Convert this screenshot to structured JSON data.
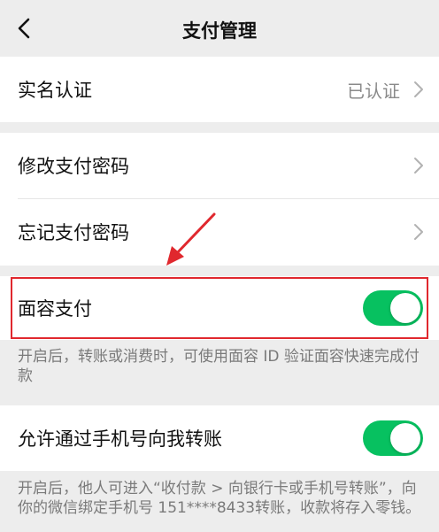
{
  "header": {
    "title": "支付管理",
    "back_icon": "chevron-left-icon"
  },
  "rows": {
    "real_name": {
      "label": "实名认证",
      "value": "已认证"
    },
    "change_password": {
      "label": "修改支付密码"
    },
    "forgot_password": {
      "label": "忘记支付密码"
    },
    "face_pay": {
      "label": "面容支付",
      "enabled": true,
      "hint": "开启后，转账或消费时，可使用面容 ID 验证面容快速完成付款"
    },
    "phone_transfer": {
      "label": "允许通过手机号向我转账",
      "enabled": true,
      "hint": "开启后，他人可进入“收付款 > 向银行卡或手机号转账”，向你的微信绑定手机号 151****8433转账，收款将存入零钱。"
    }
  },
  "colors": {
    "toggle_on": "#07c160",
    "highlight": "#e0282e",
    "background": "#ededed"
  }
}
